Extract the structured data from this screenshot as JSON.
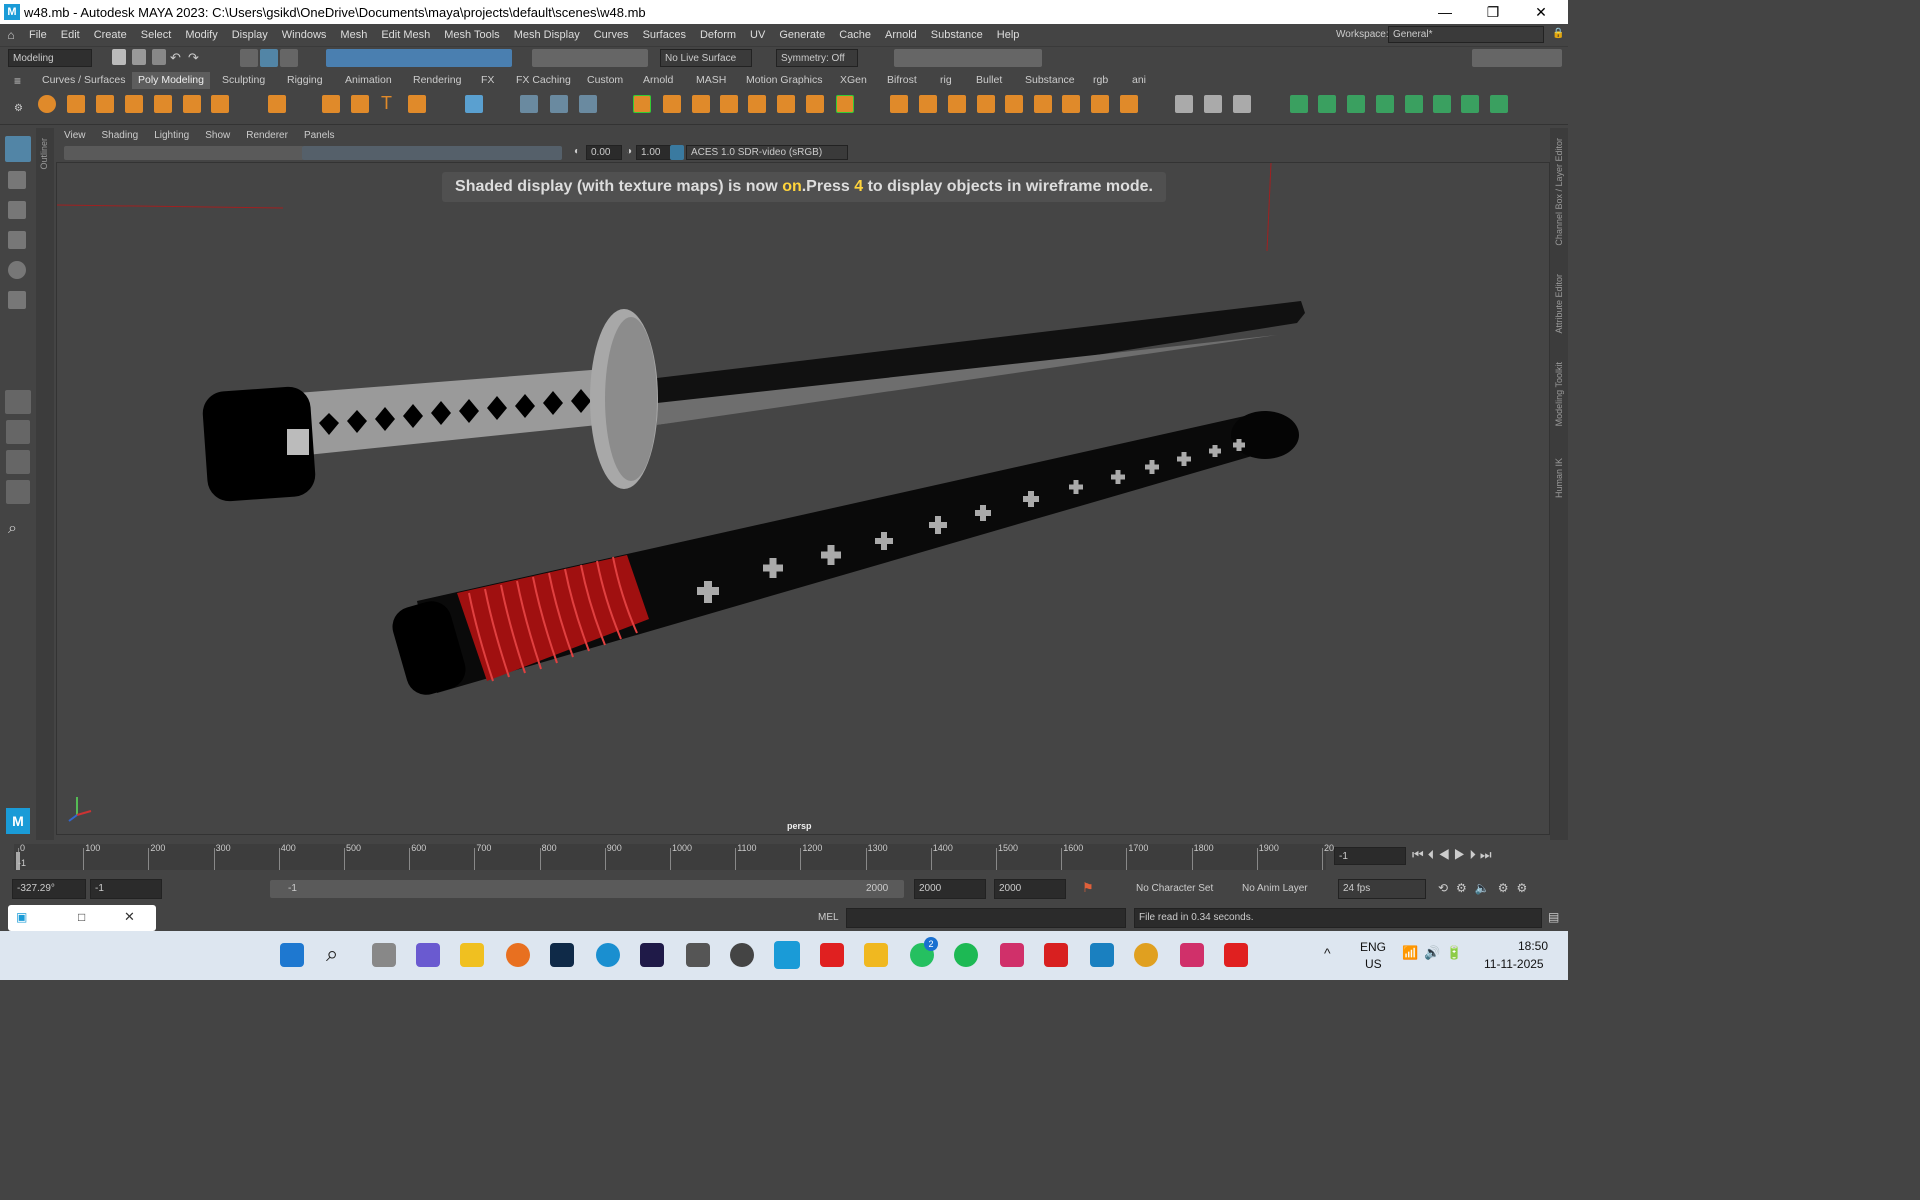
{
  "window": {
    "title": "w48.mb - Autodesk MAYA 2023: C:\\Users\\gsikd\\OneDrive\\Documents\\maya\\projects\\default\\scenes\\w48.mb",
    "logo": "M",
    "min": "—",
    "max": "❐",
    "close": "✕"
  },
  "menus": [
    "File",
    "Edit",
    "Create",
    "Select",
    "Modify",
    "Display",
    "Windows",
    "Mesh",
    "Edit Mesh",
    "Mesh Tools",
    "Mesh Display",
    "Curves",
    "Surfaces",
    "Deform",
    "UV",
    "Generate",
    "Cache",
    "Arnold",
    "Substance",
    "Help"
  ],
  "workspace": {
    "label": "Workspace:",
    "value": "General*"
  },
  "status": {
    "mode": "Modeling",
    "live_surface": "No Live Surface",
    "symmetry": "Symmetry: Off"
  },
  "shelf_tabs": [
    "Curves / Surfaces",
    "Poly Modeling",
    "Sculpting",
    "Rigging",
    "Animation",
    "Rendering",
    "FX",
    "FX Caching",
    "Custom",
    "Arnold",
    "MASH",
    "Motion Graphics",
    "XGen",
    "Bifrost",
    "rig",
    "Bullet",
    "Substance",
    "rgb",
    "ani"
  ],
  "shelf_active": "Poly Modeling",
  "panel_menus": [
    "View",
    "Shading",
    "Lighting",
    "Show",
    "Renderer",
    "Panels"
  ],
  "panel": {
    "exposure": "0.00",
    "gamma": "1.00",
    "colorspace": "ACES 1.0 SDR-video (sRGB)"
  },
  "hud": {
    "pre": "Shaded display (with texture maps) is now ",
    "on": "on",
    "mid": ".Press ",
    "key": "4",
    "post": " to display objects in wireframe mode."
  },
  "camera": "persp",
  "side_tabs": {
    "outliner": "Outliner",
    "channel": "Channel Box / Layer Editor",
    "attr": "Attribute Editor",
    "modeling": "Modeling Toolkit",
    "humanik": "Human IK"
  },
  "timeline": {
    "ticks": [
      "0",
      "100",
      "200",
      "300",
      "400",
      "500",
      "600",
      "700",
      "800",
      "900",
      "1000",
      "1100",
      "1200",
      "1300",
      "1400",
      "1500",
      "1600",
      "1700",
      "1800",
      "1900",
      "20"
    ],
    "start_label": "-1",
    "current_frame": "-1"
  },
  "range": {
    "coord": "-327.29°",
    "start": "-1",
    "slider_start": "-1",
    "slider_end": "2000",
    "end": "2000",
    "end2": "2000",
    "charset": "No Character Set",
    "animlayer": "No Anim Layer",
    "fps": "24 fps"
  },
  "cmd": {
    "label": "MEL",
    "result": "File read in  0.34 seconds."
  },
  "taskbar": {
    "lang1": "ENG",
    "lang2": "US",
    "time": "18:50",
    "date": "11-11-2025",
    "badge": "2"
  },
  "colors": {
    "ui_bg": "#444444",
    "viewport": "#454545",
    "accent": "#5285a6",
    "hud_yellow": "#ffd43b",
    "sword_red": "#b01010"
  }
}
